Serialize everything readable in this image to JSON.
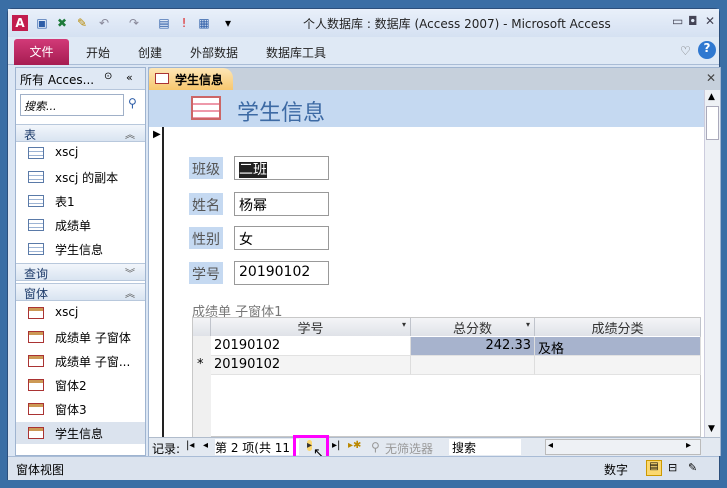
{
  "window": {
    "title": "个人数据库 : 数据库 (Access 2007)  -  Microsoft Access"
  },
  "ribbon": {
    "tabs": [
      "文件",
      "开始",
      "创建",
      "外部数据",
      "数据库工具"
    ]
  },
  "nav": {
    "header": "所有 Acces...",
    "search_placeholder": "搜索...",
    "groups": [
      {
        "label": "表",
        "items": [
          "xscj",
          "xscj 的副本",
          "表1",
          "成绩单",
          "学生信息"
        ]
      },
      {
        "label": "查询",
        "items": []
      },
      {
        "label": "窗体",
        "items": [
          "xscj",
          "成绩单 子窗体",
          "成绩单 子窗...",
          "窗体2",
          "窗体3",
          "学生信息"
        ]
      }
    ]
  },
  "document": {
    "tab": "学生信息",
    "form_title": "学生信息",
    "fields": [
      {
        "label": "班级",
        "value": "二班"
      },
      {
        "label": "姓名",
        "value": "杨幂"
      },
      {
        "label": "性别",
        "value": "女"
      },
      {
        "label": "学号",
        "value": "20190102"
      }
    ],
    "subform": {
      "label": "成绩单 子窗体1",
      "columns": [
        "学号",
        "总分数",
        "成绩分类"
      ],
      "rows": [
        [
          "20190102",
          "242.33",
          "及格"
        ]
      ],
      "new_row": "20190102",
      "new_row_marker": "*"
    }
  },
  "record_nav": {
    "label": "记录:",
    "position": "第 2 项(共 11",
    "filter": "无筛选器",
    "search": "搜索"
  },
  "status": {
    "left": "窗体视图",
    "mode": "数字"
  },
  "colors": {
    "file_tab": "#b8265f",
    "highlight": "#ff00ff",
    "header": "#c5d9f1"
  }
}
